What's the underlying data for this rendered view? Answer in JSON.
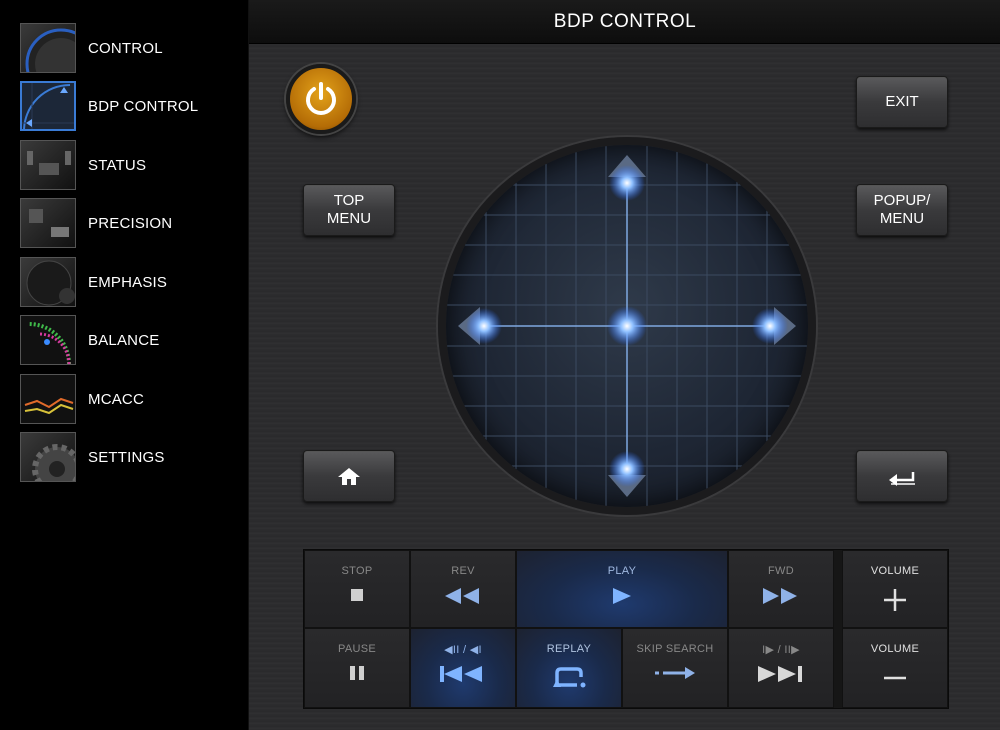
{
  "sidebar": {
    "items": [
      {
        "label": "CONTROL",
        "icon": "knob-icon"
      },
      {
        "label": "BDP CONTROL",
        "icon": "radar-icon",
        "active": true
      },
      {
        "label": "STATUS",
        "icon": "room-icon"
      },
      {
        "label": "PRECISION",
        "icon": "speaker-room-icon"
      },
      {
        "label": "EMPHASIS",
        "icon": "speaker-icon"
      },
      {
        "label": "BALANCE",
        "icon": "balance-meter-icon"
      },
      {
        "label": "MCACC",
        "icon": "mcacc-graph-icon"
      },
      {
        "label": "SETTINGS",
        "icon": "gear-icon"
      }
    ]
  },
  "header": {
    "title": "BDP CONTROL"
  },
  "buttons": {
    "exit": "EXIT",
    "top_menu_1": "TOP",
    "top_menu_2": "MENU",
    "popup_menu_1": "POPUP/",
    "popup_menu_2": "MENU"
  },
  "transport": {
    "stop": "STOP",
    "rev": "REV",
    "play": "PLAY",
    "fwd": "FWD",
    "volume_up": "VOLUME",
    "pause": "PAUSE",
    "step_rev": "◀II / ◀I",
    "replay": "REPLAY",
    "skip_search": "SKIP SEARCH",
    "step_fwd": "I▶ / II▶",
    "volume_down": "VOLUME"
  },
  "colors": {
    "accent_blue": "#3a7bd5",
    "power_orange": "#d8920f",
    "glow_blue": "#6aa8ff"
  }
}
